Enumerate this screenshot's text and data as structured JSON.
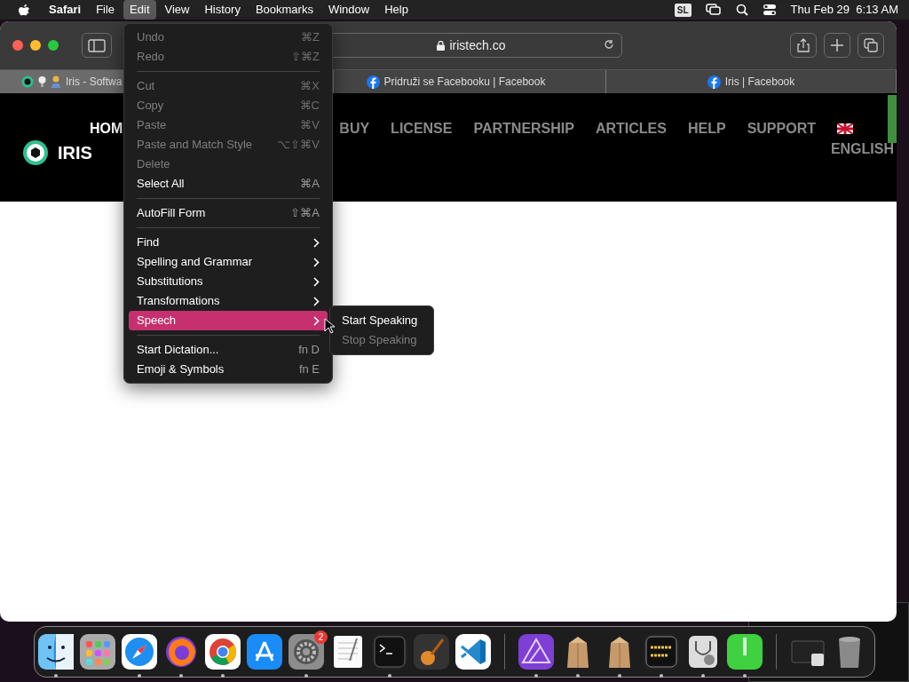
{
  "menubar": {
    "items": [
      {
        "label": "Safari",
        "kind": "app",
        "selected": false
      },
      {
        "label": "File",
        "kind": "menu",
        "selected": false
      },
      {
        "label": "Edit",
        "kind": "menu",
        "selected": true
      },
      {
        "label": "View",
        "kind": "menu",
        "selected": false
      },
      {
        "label": "History",
        "kind": "menu",
        "selected": false
      },
      {
        "label": "Bookmarks",
        "kind": "menu",
        "selected": false
      },
      {
        "label": "Window",
        "kind": "menu",
        "selected": false
      },
      {
        "label": "Help",
        "kind": "menu",
        "selected": false
      }
    ],
    "input_source": "SL",
    "clock": "Thu Feb 29  6:13 AM"
  },
  "edit_menu": {
    "items": [
      {
        "kind": "item",
        "label": "Undo",
        "shortcut": "⌘Z",
        "disabled": true,
        "arrow": false,
        "selected": false
      },
      {
        "kind": "item",
        "label": "Redo",
        "shortcut": "⇧⌘Z",
        "disabled": true,
        "arrow": false,
        "selected": false
      },
      {
        "kind": "separator"
      },
      {
        "kind": "item",
        "label": "Cut",
        "shortcut": "⌘X",
        "disabled": true,
        "arrow": false,
        "selected": false
      },
      {
        "kind": "item",
        "label": "Copy",
        "shortcut": "⌘C",
        "disabled": true,
        "arrow": false,
        "selected": false
      },
      {
        "kind": "item",
        "label": "Paste",
        "shortcut": "⌘V",
        "disabled": true,
        "arrow": false,
        "selected": false
      },
      {
        "kind": "item",
        "label": "Paste and Match Style",
        "shortcut": "⌥⇧⌘V",
        "disabled": true,
        "arrow": false,
        "selected": false
      },
      {
        "kind": "item",
        "label": "Delete",
        "disabled": true,
        "arrow": false,
        "selected": false
      },
      {
        "kind": "item",
        "label": "Select All",
        "shortcut": "⌘A",
        "disabled": false,
        "arrow": false,
        "selected": false
      },
      {
        "kind": "separator"
      },
      {
        "kind": "item",
        "label": "AutoFill Form",
        "shortcut": "⇧⌘A",
        "disabled": false,
        "arrow": false,
        "selected": false
      },
      {
        "kind": "separator"
      },
      {
        "kind": "item",
        "label": "Find",
        "disabled": false,
        "arrow": true,
        "selected": false
      },
      {
        "kind": "item",
        "label": "Spelling and Grammar",
        "disabled": false,
        "arrow": true,
        "selected": false
      },
      {
        "kind": "item",
        "label": "Substitutions",
        "disabled": false,
        "arrow": true,
        "selected": false
      },
      {
        "kind": "item",
        "label": "Transformations",
        "disabled": false,
        "arrow": true,
        "selected": false
      },
      {
        "kind": "item",
        "label": "Speech",
        "disabled": false,
        "arrow": true,
        "selected": true,
        "submenu": [
          {
            "label": "Start Speaking",
            "disabled": false
          },
          {
            "label": "Stop Speaking",
            "disabled": true
          }
        ]
      },
      {
        "kind": "separator"
      },
      {
        "kind": "item",
        "label": "Start Dictation...",
        "shortcut": "fn D",
        "disabled": false,
        "arrow": false,
        "selected": false
      },
      {
        "kind": "item",
        "label": "Emoji & Symbols",
        "shortcut": "fn E",
        "disabled": false,
        "arrow": false,
        "selected": false
      }
    ]
  },
  "browser": {
    "address": "iristech.co",
    "tabs": [
      {
        "title": "Iris - Softwa",
        "selected": true
      },
      {
        "title": "Pridruži se Facebooku | Facebook",
        "selected": false
      },
      {
        "title": "Iris | Facebook",
        "selected": false
      }
    ]
  },
  "website": {
    "logo_text": "IRIS",
    "nav": [
      "HOM",
      "BUY",
      "LICENSE",
      "PARTNERSHIP",
      "ARTICLES",
      "HELP",
      "SUPPORT"
    ],
    "language": "ENGLISH"
  },
  "dock": {
    "apps": [
      {
        "kind": "finder",
        "running": true
      },
      {
        "kind": "launchpad",
        "running": false
      },
      {
        "kind": "safari",
        "running": true
      },
      {
        "kind": "firefox",
        "running": true
      },
      {
        "kind": "chrome",
        "running": true
      },
      {
        "kind": "appstore",
        "running": false
      },
      {
        "kind": "settings",
        "running": true,
        "badge": "2"
      },
      {
        "kind": "textedit",
        "running": false
      },
      {
        "kind": "terminal",
        "running": true
      },
      {
        "kind": "garageband",
        "running": false
      },
      {
        "kind": "vscode",
        "running": false
      },
      {
        "kind": "separator"
      },
      {
        "kind": "affinity",
        "running": true
      },
      {
        "kind": "box",
        "running": true
      },
      {
        "kind": "box",
        "running": true
      },
      {
        "kind": "console",
        "running": true
      },
      {
        "kind": "diskutility",
        "running": true
      },
      {
        "kind": "green",
        "running": true
      },
      {
        "kind": "separator"
      },
      {
        "kind": "minimized",
        "running": false
      },
      {
        "kind": "trash",
        "running": false
      }
    ]
  }
}
